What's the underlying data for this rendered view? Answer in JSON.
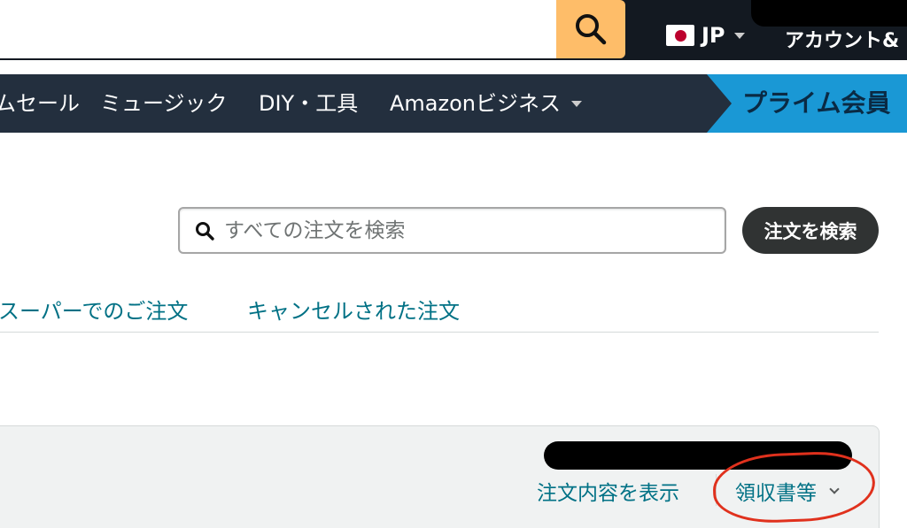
{
  "header": {
    "search_button_icon": "search-icon",
    "language": "JP",
    "flag_icon": "japan-flag-icon",
    "account_label": "アカウント&"
  },
  "nav": {
    "items": [
      "ムセール",
      "ミュージック",
      "DIY・工具",
      "Amazonビジネス"
    ],
    "prime_banner": "プライム会員"
  },
  "orders": {
    "search_placeholder": "すべての注文を検索",
    "search_button": "注文を検索",
    "tabs": [
      "スーパーでのご注文",
      "キャンセルされた注文"
    ],
    "card": {
      "view_details": "注文内容を表示",
      "receipt": "領収書等"
    }
  },
  "colors": {
    "header_bg": "#131921",
    "nav_bg": "#232f3e",
    "search_button": "#febd69",
    "prime_banner": "#1a98d5",
    "link": "#007185",
    "annotation": "#e0311d"
  }
}
